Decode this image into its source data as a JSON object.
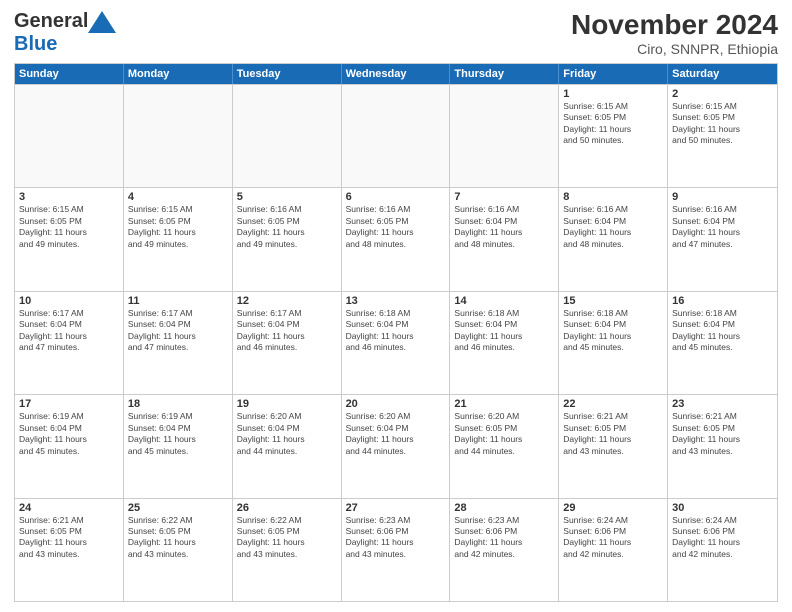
{
  "logo": {
    "line1": "General",
    "line2": "Blue"
  },
  "title": "November 2024",
  "subtitle": "Ciro, SNNPR, Ethiopia",
  "days": [
    "Sunday",
    "Monday",
    "Tuesday",
    "Wednesday",
    "Thursday",
    "Friday",
    "Saturday"
  ],
  "weeks": [
    [
      {
        "day": "",
        "info": ""
      },
      {
        "day": "",
        "info": ""
      },
      {
        "day": "",
        "info": ""
      },
      {
        "day": "",
        "info": ""
      },
      {
        "day": "",
        "info": ""
      },
      {
        "day": "1",
        "info": "Sunrise: 6:15 AM\nSunset: 6:05 PM\nDaylight: 11 hours\nand 50 minutes."
      },
      {
        "day": "2",
        "info": "Sunrise: 6:15 AM\nSunset: 6:05 PM\nDaylight: 11 hours\nand 50 minutes."
      }
    ],
    [
      {
        "day": "3",
        "info": "Sunrise: 6:15 AM\nSunset: 6:05 PM\nDaylight: 11 hours\nand 49 minutes."
      },
      {
        "day": "4",
        "info": "Sunrise: 6:15 AM\nSunset: 6:05 PM\nDaylight: 11 hours\nand 49 minutes."
      },
      {
        "day": "5",
        "info": "Sunrise: 6:16 AM\nSunset: 6:05 PM\nDaylight: 11 hours\nand 49 minutes."
      },
      {
        "day": "6",
        "info": "Sunrise: 6:16 AM\nSunset: 6:05 PM\nDaylight: 11 hours\nand 48 minutes."
      },
      {
        "day": "7",
        "info": "Sunrise: 6:16 AM\nSunset: 6:04 PM\nDaylight: 11 hours\nand 48 minutes."
      },
      {
        "day": "8",
        "info": "Sunrise: 6:16 AM\nSunset: 6:04 PM\nDaylight: 11 hours\nand 48 minutes."
      },
      {
        "day": "9",
        "info": "Sunrise: 6:16 AM\nSunset: 6:04 PM\nDaylight: 11 hours\nand 47 minutes."
      }
    ],
    [
      {
        "day": "10",
        "info": "Sunrise: 6:17 AM\nSunset: 6:04 PM\nDaylight: 11 hours\nand 47 minutes."
      },
      {
        "day": "11",
        "info": "Sunrise: 6:17 AM\nSunset: 6:04 PM\nDaylight: 11 hours\nand 47 minutes."
      },
      {
        "day": "12",
        "info": "Sunrise: 6:17 AM\nSunset: 6:04 PM\nDaylight: 11 hours\nand 46 minutes."
      },
      {
        "day": "13",
        "info": "Sunrise: 6:18 AM\nSunset: 6:04 PM\nDaylight: 11 hours\nand 46 minutes."
      },
      {
        "day": "14",
        "info": "Sunrise: 6:18 AM\nSunset: 6:04 PM\nDaylight: 11 hours\nand 46 minutes."
      },
      {
        "day": "15",
        "info": "Sunrise: 6:18 AM\nSunset: 6:04 PM\nDaylight: 11 hours\nand 45 minutes."
      },
      {
        "day": "16",
        "info": "Sunrise: 6:18 AM\nSunset: 6:04 PM\nDaylight: 11 hours\nand 45 minutes."
      }
    ],
    [
      {
        "day": "17",
        "info": "Sunrise: 6:19 AM\nSunset: 6:04 PM\nDaylight: 11 hours\nand 45 minutes."
      },
      {
        "day": "18",
        "info": "Sunrise: 6:19 AM\nSunset: 6:04 PM\nDaylight: 11 hours\nand 45 minutes."
      },
      {
        "day": "19",
        "info": "Sunrise: 6:20 AM\nSunset: 6:04 PM\nDaylight: 11 hours\nand 44 minutes."
      },
      {
        "day": "20",
        "info": "Sunrise: 6:20 AM\nSunset: 6:04 PM\nDaylight: 11 hours\nand 44 minutes."
      },
      {
        "day": "21",
        "info": "Sunrise: 6:20 AM\nSunset: 6:05 PM\nDaylight: 11 hours\nand 44 minutes."
      },
      {
        "day": "22",
        "info": "Sunrise: 6:21 AM\nSunset: 6:05 PM\nDaylight: 11 hours\nand 43 minutes."
      },
      {
        "day": "23",
        "info": "Sunrise: 6:21 AM\nSunset: 6:05 PM\nDaylight: 11 hours\nand 43 minutes."
      }
    ],
    [
      {
        "day": "24",
        "info": "Sunrise: 6:21 AM\nSunset: 6:05 PM\nDaylight: 11 hours\nand 43 minutes."
      },
      {
        "day": "25",
        "info": "Sunrise: 6:22 AM\nSunset: 6:05 PM\nDaylight: 11 hours\nand 43 minutes."
      },
      {
        "day": "26",
        "info": "Sunrise: 6:22 AM\nSunset: 6:05 PM\nDaylight: 11 hours\nand 43 minutes."
      },
      {
        "day": "27",
        "info": "Sunrise: 6:23 AM\nSunset: 6:06 PM\nDaylight: 11 hours\nand 43 minutes."
      },
      {
        "day": "28",
        "info": "Sunrise: 6:23 AM\nSunset: 6:06 PM\nDaylight: 11 hours\nand 42 minutes."
      },
      {
        "day": "29",
        "info": "Sunrise: 6:24 AM\nSunset: 6:06 PM\nDaylight: 11 hours\nand 42 minutes."
      },
      {
        "day": "30",
        "info": "Sunrise: 6:24 AM\nSunset: 6:06 PM\nDaylight: 11 hours\nand 42 minutes."
      }
    ]
  ]
}
